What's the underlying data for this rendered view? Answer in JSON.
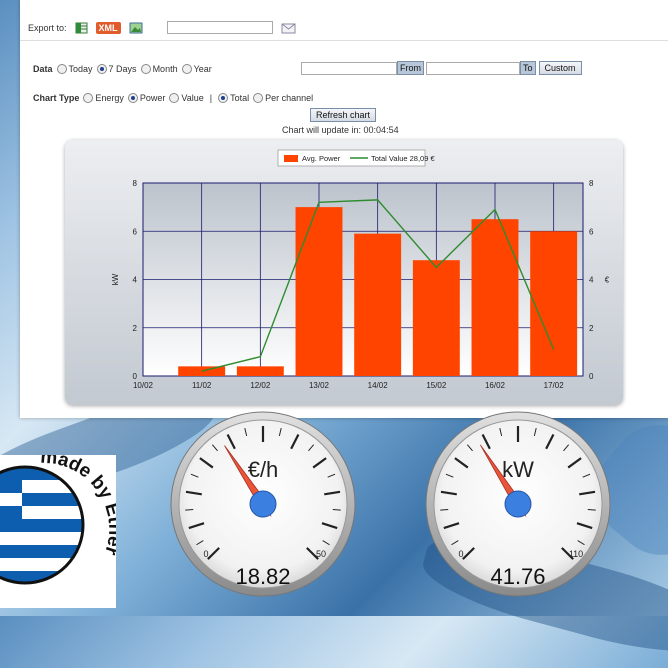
{
  "export": {
    "label": "Export to:",
    "xml_label": "XML",
    "field_value": ""
  },
  "data_row": {
    "label": "Data",
    "options": [
      {
        "label": "Today",
        "selected": false
      },
      {
        "label": "7 Days",
        "selected": true
      },
      {
        "label": "Month",
        "selected": false
      },
      {
        "label": "Year",
        "selected": false
      }
    ],
    "from_value": "",
    "from_button": "From",
    "to_value": "",
    "to_button": "To",
    "custom_button": "Custom"
  },
  "chart_type_row": {
    "label": "Chart Type",
    "type_options": [
      {
        "label": "Energy",
        "selected": false
      },
      {
        "label": "Power",
        "selected": true
      },
      {
        "label": "Value",
        "selected": false
      }
    ],
    "separator": "|",
    "scope_options": [
      {
        "label": "Total",
        "selected": true
      },
      {
        "label": "Per channel",
        "selected": false
      }
    ]
  },
  "refresh": {
    "button": "Refresh chart",
    "countdown": "Chart will update in: 00:04:54"
  },
  "chart_data": {
    "type": "bar",
    "categories": [
      "10/02",
      "11/02",
      "12/02",
      "13/02",
      "14/02",
      "15/02",
      "16/02",
      "17/02"
    ],
    "series": [
      {
        "name": "Avg. Power",
        "type": "bar",
        "axis": "left",
        "color": "#ff4400",
        "values": [
          null,
          0.4,
          0.4,
          7.0,
          5.9,
          4.8,
          6.5,
          6.0
        ]
      },
      {
        "name": "Total Value 28,09 €",
        "type": "line",
        "axis": "right",
        "color": "#2e8b2e",
        "values": [
          null,
          0.2,
          0.8,
          7.2,
          7.3,
          4.5,
          6.9,
          1.1
        ]
      }
    ],
    "ylabel": "kW",
    "y2label": "€",
    "ylim": [
      0,
      8
    ],
    "y2lim": [
      0,
      8
    ],
    "yticks": [
      "0",
      "2",
      "4",
      "6",
      "8"
    ],
    "grid": true,
    "legend": "top-center"
  },
  "gauges": [
    {
      "unit": "€/h",
      "min": "0",
      "max": "50",
      "max_value": 50,
      "value": 18.82,
      "value_text": "18.82"
    },
    {
      "unit": "kW",
      "min": "0",
      "max": "110",
      "max_value": 110,
      "value": 41.76,
      "value_text": "41.76"
    }
  ],
  "badge": {
    "text": "made by Ether"
  },
  "colors": {
    "bar": "#ff4400",
    "line": "#2e8b2e",
    "needle": "#e8553a",
    "hub": "#3b7fe0"
  }
}
